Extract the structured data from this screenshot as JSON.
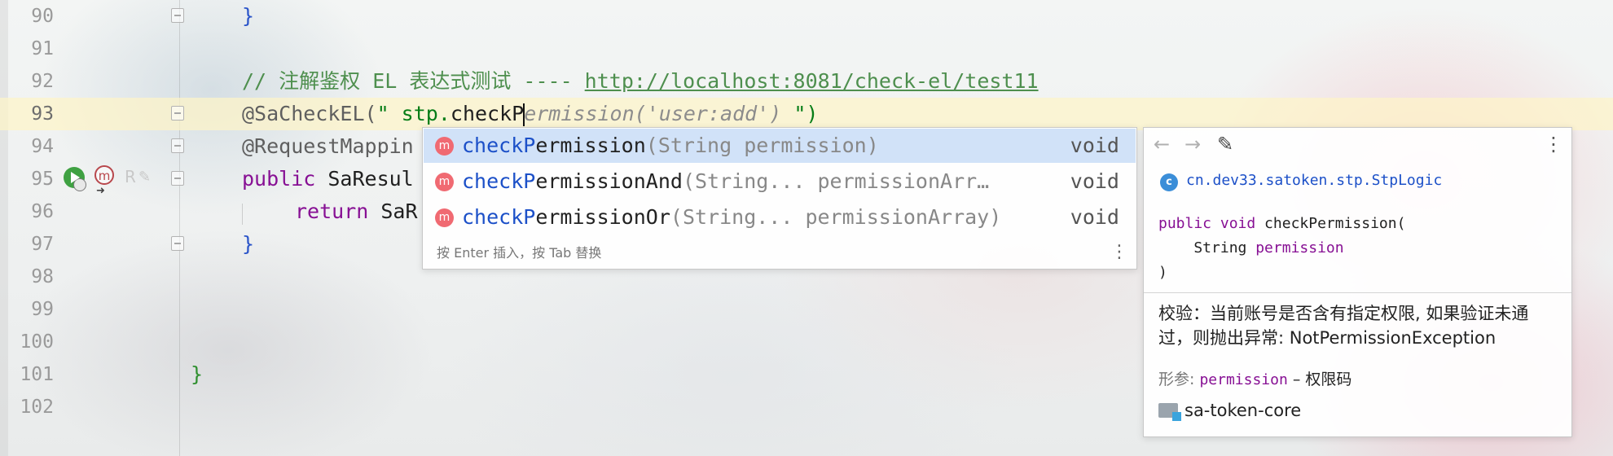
{
  "editor": {
    "lines": [
      {
        "num": "90",
        "code": "}"
      },
      {
        "num": "91"
      },
      {
        "num": "92",
        "comment": "// 注解鉴权 EL 表达式测试 ---- ",
        "url": "http://localhost:8081/check-el/test11"
      },
      {
        "num": "93",
        "annotation": "@SaCheckEL(",
        "string": "\" stp.",
        "typed": "checkP",
        "ghost": "ermission('user:add') ",
        "string_end": "\")"
      },
      {
        "num": "94",
        "code": "@RequestMappin"
      },
      {
        "num": "95",
        "kw": "public",
        "rest": " SaResul"
      },
      {
        "num": "96",
        "kw": "return",
        "rest": " SaR"
      },
      {
        "num": "97",
        "code": "}"
      },
      {
        "num": "98"
      },
      {
        "num": "99"
      },
      {
        "num": "100"
      },
      {
        "num": "101",
        "code": "}"
      },
      {
        "num": "102"
      }
    ]
  },
  "gutter": {
    "line95_icons": [
      "run-icon",
      "method-icon",
      "arrow-icon",
      "r-icon",
      "pen-icon"
    ],
    "m_glyph": "m",
    "r_glyph": "R"
  },
  "completion": {
    "items": [
      {
        "match": "checkP",
        "rest": "ermission",
        "params": "(String permission)",
        "type": "void",
        "icon": "m"
      },
      {
        "match": "checkP",
        "rest": "ermissionAnd",
        "params": "(String... permissionArr…",
        "type": "void",
        "icon": "m"
      },
      {
        "match": "checkP",
        "rest": "ermissionOr",
        "params": "(String... permissionArray)",
        "type": "void",
        "icon": "m"
      }
    ],
    "hint": "按 Enter 插入，按 Tab 替换",
    "menu_glyph": "⋮"
  },
  "doc": {
    "toolbar": {
      "back": "←",
      "forward": "→",
      "edit": "✎",
      "more": "⋮"
    },
    "class_icon": "c",
    "class_name": "cn.dev33.satoken.stp.StpLogic",
    "signature": {
      "kw": "public void",
      "name": " checkPermission(",
      "param_type": "    String ",
      "param_name": "permission",
      "close": ")"
    },
    "description": "校验：当前账号是否含有指定权限, 如果验证未通过，则抛出异常: NotPermissionException",
    "param_label": "形参:",
    "param_name": "permission",
    "param_desc": " – 权限码",
    "module": "sa-token-core"
  },
  "colors": {
    "current_line": "#fdf4c8",
    "selection": "#d1e2f8",
    "method_icon": "#f06a72",
    "class_icon": "#3b8ed8",
    "comment": "#4e8f4e"
  }
}
